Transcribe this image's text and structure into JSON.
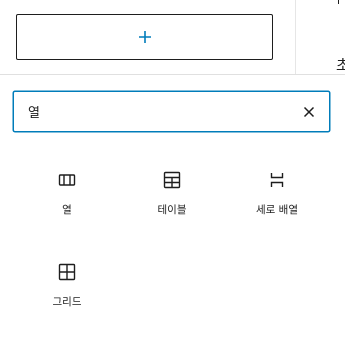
{
  "editor": {
    "appender_icon": "plus-icon",
    "edge_text": "초"
  },
  "search": {
    "value": "열",
    "clear_icon": "close-icon"
  },
  "results": [
    {
      "label": "열",
      "icon": "columns-icon"
    },
    {
      "label": "테이블",
      "icon": "table-icon"
    },
    {
      "label": "세로 배열",
      "icon": "stack-icon"
    },
    {
      "label": "그리드",
      "icon": "grid-icon"
    }
  ],
  "colors": {
    "accent": "#007cba",
    "text": "#1e1e1e"
  }
}
